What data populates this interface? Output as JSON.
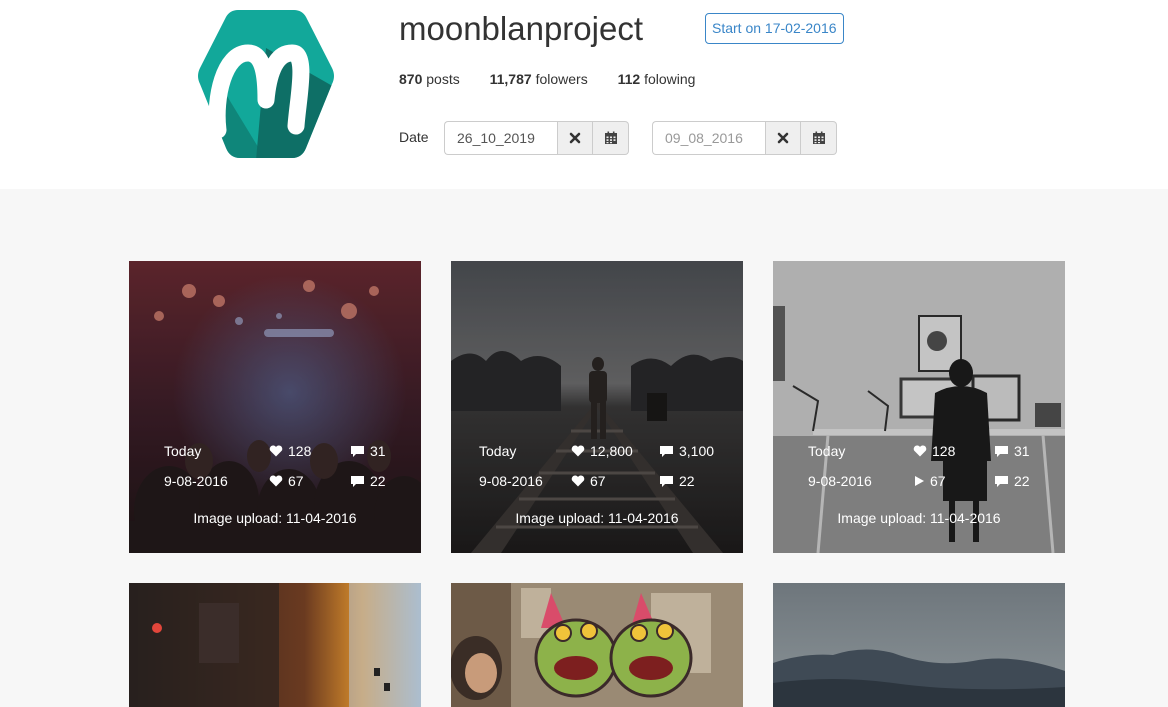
{
  "profile": {
    "username": "moonblanproject",
    "start_label": "Start on 17-02-2016",
    "stats": {
      "posts_count": "870",
      "posts_label": "posts",
      "followers_count": "11,787",
      "followers_label": "folowers",
      "following_count": "112",
      "following_label": "folowing"
    }
  },
  "date_filter": {
    "label": "Date",
    "from_value": "26_10_2019",
    "to_placeholder": "09_08_2016"
  },
  "colors": {
    "accent": "#3a86c8",
    "logo_light": "#12a89a",
    "logo_dark": "#0e6f66"
  },
  "posts": [
    {
      "today_label": "Today",
      "today_likes": "128",
      "today_comments": "31",
      "date_label": "9-08-2016",
      "date_likes": "67",
      "date_comments": "22",
      "date_like_icon": "heart-icon",
      "upload": "Image upload: 11-04-2016"
    },
    {
      "today_label": "Today",
      "today_likes": "12,800",
      "today_comments": "3,100",
      "date_label": "9-08-2016",
      "date_likes": "67",
      "date_comments": "22",
      "date_like_icon": "heart-icon",
      "upload": "Image upload: 11-04-2016"
    },
    {
      "today_label": "Today",
      "today_likes": "128",
      "today_comments": "31",
      "date_label": "9-08-2016",
      "date_likes": "67",
      "date_comments": "22",
      "date_like_icon": "play-icon",
      "upload": "Image upload: 11-04-2016"
    }
  ]
}
